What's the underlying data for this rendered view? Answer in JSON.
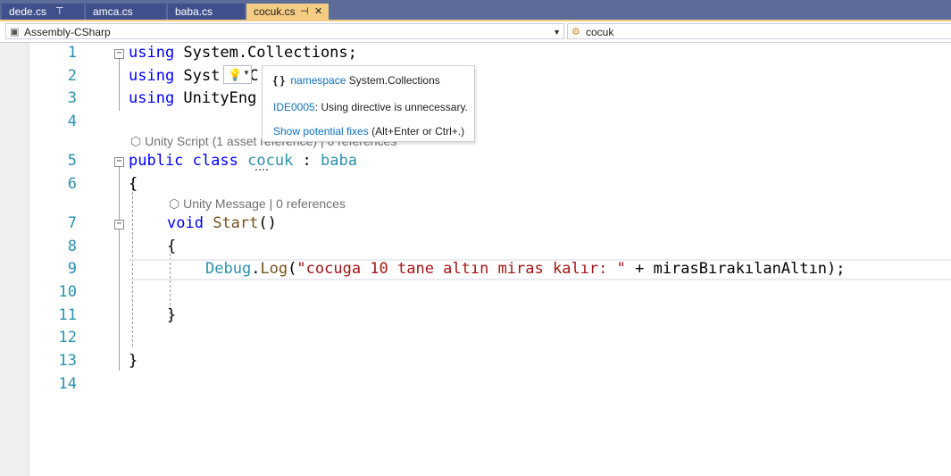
{
  "tabs": [
    {
      "label": "dede.cs",
      "pin": "⊤"
    },
    {
      "label": "amca.cs"
    },
    {
      "label": "baba.cs"
    },
    {
      "label": "cocuk.cs",
      "pin": "⊣",
      "close": "✕"
    }
  ],
  "navbar": {
    "project": "Assembly-CSharp",
    "member": "cocuk"
  },
  "line_numbers": [
    "1",
    "2",
    "3",
    "4",
    "5",
    "6",
    "7",
    "8",
    "9",
    "10",
    "11",
    "12",
    "13",
    "14"
  ],
  "code": {
    "l1_kw": "using",
    "l1_rest": " System.Collections;",
    "l2_kw": "using",
    "l2_rest": " Syst",
    "l2_after": "C",
    "l3_kw": "using",
    "l3_rest": " UnityEng",
    "lens1": "Unity Script (1 asset reference) | 0 references",
    "l5_kw1": "public",
    "l5_kw2": "class",
    "l5_name": "cocuk",
    "l5_colon": " : ",
    "l5_base": "baba",
    "l6": "{",
    "lens2": "Unity Message | 0 references",
    "l7_kw": "void",
    "l7_name": "Start",
    "l7_paren": "()",
    "l8": "{",
    "l9_type": "Debug",
    "l9_dot": ".",
    "l9_method": "Log",
    "l9_open": "(",
    "l9_str": "\"cocuga 10 tane altın miras kalır: \"",
    "l9_rest": " + mirasBırakılanAltın);",
    "l11": "}",
    "l13": "}"
  },
  "tooltip": {
    "braces": "{ }",
    "ns_kw": "namespace",
    "ns_name": " System.Collections",
    "code_id": "IDE0005",
    "message": ": Using directive is unnecessary.",
    "fix_link": "Show potential fixes",
    "fix_shortcut": " (Alt+Enter or Ctrl+.)"
  },
  "icons": {
    "lightbulb": "lightbulb-icon",
    "cube": "unity-cube-icon"
  }
}
